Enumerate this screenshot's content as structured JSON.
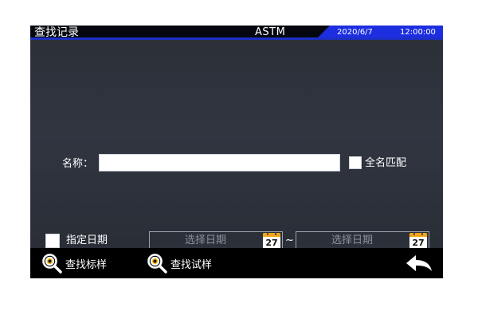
{
  "header": {
    "title": "查找记录",
    "mode": "ASTM",
    "date": "2020/6/7",
    "time": "12:00:00"
  },
  "form": {
    "name_label": "名称：",
    "name_value": "",
    "fullname_checkbox_label": "全名匹配",
    "fullname_checked": false,
    "date_checkbox_label": "指定日期",
    "date_checked": false,
    "start_date_placeholder": "选择日期",
    "end_date_placeholder": "选择日期",
    "range_separator": "~",
    "calendar_icon_number": "27"
  },
  "footer": {
    "find_standard_label": "查找标样",
    "find_sample_label": "查找试样"
  },
  "icons": {
    "search": "magnifier-icon",
    "calendar": "calendar-icon",
    "back": "back-arrow-icon"
  },
  "colors": {
    "accent_blue": "#1c2ee0",
    "calendar_orange": "#f2a516",
    "panel": "#2b2f37"
  }
}
